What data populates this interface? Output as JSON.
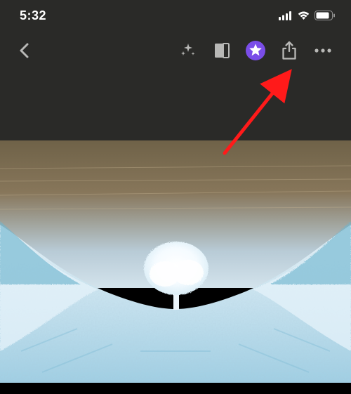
{
  "status_bar": {
    "time": "5:32"
  },
  "toolbar": {
    "back": "Back",
    "magic": "Auto Enhance",
    "filters": "Filters",
    "favorite": "Favorite",
    "share": "Share",
    "more": "More"
  },
  "colors": {
    "chrome_bg": "#2a2a28",
    "accent_star_bg": "#7a4de8",
    "icon_gray": "#b8b8b6",
    "annotation_red": "#ff1a1a"
  },
  "annotation": {
    "target": "share-button"
  }
}
